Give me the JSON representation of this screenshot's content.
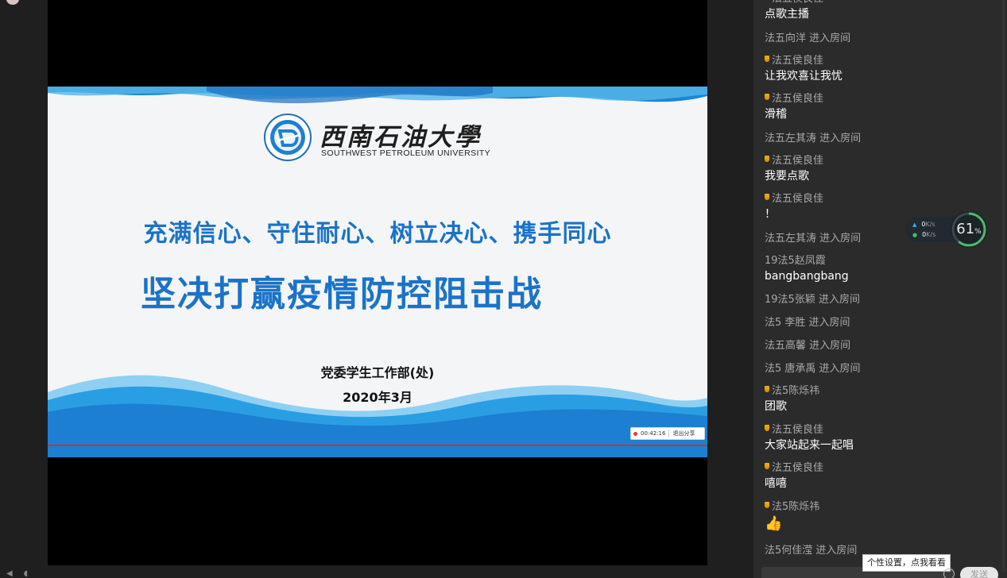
{
  "slide": {
    "logo_cn": "西南石油大學",
    "logo_en": "SOUTHWEST PETROLEUM UNIVERSITY",
    "line1": "充满信心、守住耐心、树立决心、携手同心",
    "line2": "坚决打赢疫情防控阻击战",
    "org": "党委学生工作部(处)",
    "date": "2020年3月",
    "timer": "00:42:16",
    "exit_share": "退出分享"
  },
  "chat": {
    "messages": [
      {
        "type": "msg",
        "name": "法五侯良佳",
        "text": "点歌主播"
      },
      {
        "type": "sys",
        "text": "法五向洋 进入房间"
      },
      {
        "type": "msg",
        "name": "法五侯良佳",
        "text": "让我欢喜让我忧"
      },
      {
        "type": "msg",
        "name": "法五侯良佳",
        "text": "滑稽"
      },
      {
        "type": "sys",
        "text": "法五左其涛 进入房间"
      },
      {
        "type": "msg",
        "name": "法五侯良佳",
        "text": "我要点歌"
      },
      {
        "type": "msg",
        "name": "法五侯良佳",
        "text": "！"
      },
      {
        "type": "sys",
        "text": "法五左其涛 进入房间"
      },
      {
        "type": "msg2",
        "name": "19法5赵凤霞",
        "text": "bangbangbang"
      },
      {
        "type": "sys",
        "text": "19法5张颖 进入房间"
      },
      {
        "type": "sys",
        "text": "法5 李胜 进入房间"
      },
      {
        "type": "sys",
        "text": "法五高馨 进入房间"
      },
      {
        "type": "sys",
        "text": "法5 唐承禹 进入房间"
      },
      {
        "type": "msg",
        "name": "法5陈烁祎",
        "text": "团歌"
      },
      {
        "type": "msg",
        "name": "法五侯良佳",
        "text": "大家站起来一起唱"
      },
      {
        "type": "msg",
        "name": "法五侯良佳",
        "text": "嘻嘻"
      },
      {
        "type": "msg",
        "name": "法5陈烁祎",
        "text": "thumbs-up-icon"
      },
      {
        "type": "sys",
        "text": "法5何佳滢 进入房间"
      }
    ],
    "tooltip": "个性设置，点我看看",
    "send": "发送"
  },
  "net": {
    "up": "0",
    "down": "0",
    "unit": "K/s",
    "percent": "61",
    "percent_unit": "%"
  },
  "colors": {
    "slide_blue": "#1a73c9",
    "wave_blue": "#1c86d6",
    "chat_bg": "#2b2b2b",
    "medal": "#f0b400"
  }
}
